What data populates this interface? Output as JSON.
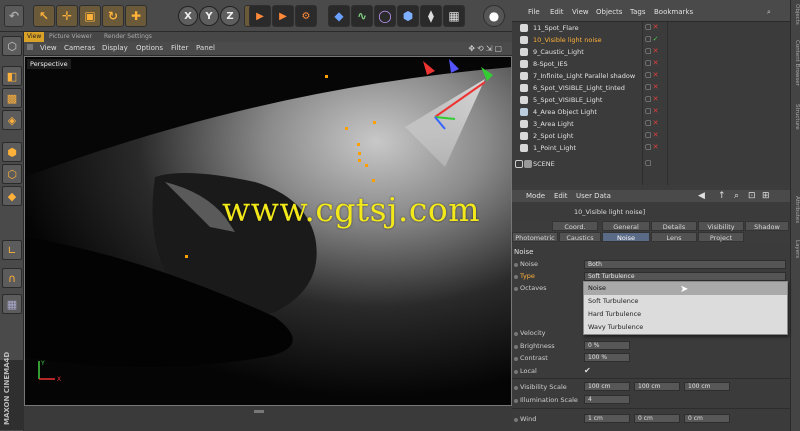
{
  "top_toolbar": {
    "axis_buttons": [
      "X",
      "Y",
      "Z"
    ],
    "icons": [
      "undo-icon",
      "move-icon",
      "scale-icon",
      "rotate-icon",
      "add-icon",
      "record-icon",
      "render-view-icon",
      "render-picture-icon",
      "render-settings-icon",
      "light-bulb-icon"
    ]
  },
  "view_tabs": [
    "View",
    "Picture Viewer",
    "Render Settings"
  ],
  "view_menu": [
    "View",
    "Cameras",
    "Display",
    "Options",
    "Filter",
    "Panel"
  ],
  "viewport": {
    "label": "Perspective",
    "axis_x": "X",
    "axis_y": "Y"
  },
  "object_manager": {
    "menu": [
      "File",
      "Edit",
      "View",
      "Objects",
      "Tags",
      "Bookmarks"
    ],
    "objects": [
      {
        "name": "11_Spot_Flare",
        "active": false
      },
      {
        "name": "10_Visible light noise",
        "active": true
      },
      {
        "name": "9_Caustic_Light",
        "active": false
      },
      {
        "name": "8-Spot_IES",
        "active": false
      },
      {
        "name": "7_Infinite_Light Parallel shadow",
        "active": false
      },
      {
        "name": "6_Spot_VISIBLE_Light_tinted",
        "active": false
      },
      {
        "name": "5_Spot_VISIBLE_Light",
        "active": false
      },
      {
        "name": "4_Area Object Light",
        "active": false
      },
      {
        "name": "3_Area Light",
        "active": false
      },
      {
        "name": "2_Spot Light",
        "active": false
      },
      {
        "name": "1_Point_Light",
        "active": false
      },
      {
        "name": "SCENE",
        "active": false
      }
    ]
  },
  "right_tabs": [
    "Objects",
    "Content Browser",
    "Structure",
    "Attributes",
    "Layers"
  ],
  "attribute_manager": {
    "menu": [
      "Mode",
      "Edit",
      "User Data"
    ],
    "title": "10_Visible light noise]",
    "tabs_row1": [
      "Coord.",
      "General",
      "Details",
      "Visibility",
      "Shadow"
    ],
    "tabs_row2": [
      "Photometric",
      "Caustics",
      "Noise",
      "Lens",
      "Project"
    ],
    "active_tab": "Noise",
    "section": "Noise",
    "noise_label": "Noise",
    "noise_value": "Both",
    "type_label": "Type",
    "type_value": "Soft Turbulence",
    "octaves_label": "Octaves",
    "popup_options": [
      "Noise",
      "Soft Turbulence",
      "Hard Turbulence",
      "Wavy Turbulence"
    ],
    "popup_highlighted": "Noise",
    "velocity_label": "Velocity",
    "brightness_label": "Brightness",
    "brightness_value": "0 %",
    "contrast_label": "Contrast",
    "contrast_value": "100 %",
    "local_label": "Local",
    "local_value": "✔",
    "visibility_scale_label": "Visibility Scale",
    "visibility_scale_values": [
      "100 cm",
      "100 cm",
      "100 cm"
    ],
    "illumination_scale_label": "Illumination Scale",
    "illumination_scale_value": "4",
    "wind_label": "Wind",
    "wind_values": [
      "1 cm",
      "0 cm",
      "0 cm"
    ]
  },
  "branding": {
    "maxon": "MAXON CINEMA4D",
    "watermark": "www.cgtsj.com"
  },
  "colors": {
    "accent_orange": "#d9a128",
    "active_tab_blue": "#5a6b88",
    "watermark_yellow": "#f2e81a"
  }
}
